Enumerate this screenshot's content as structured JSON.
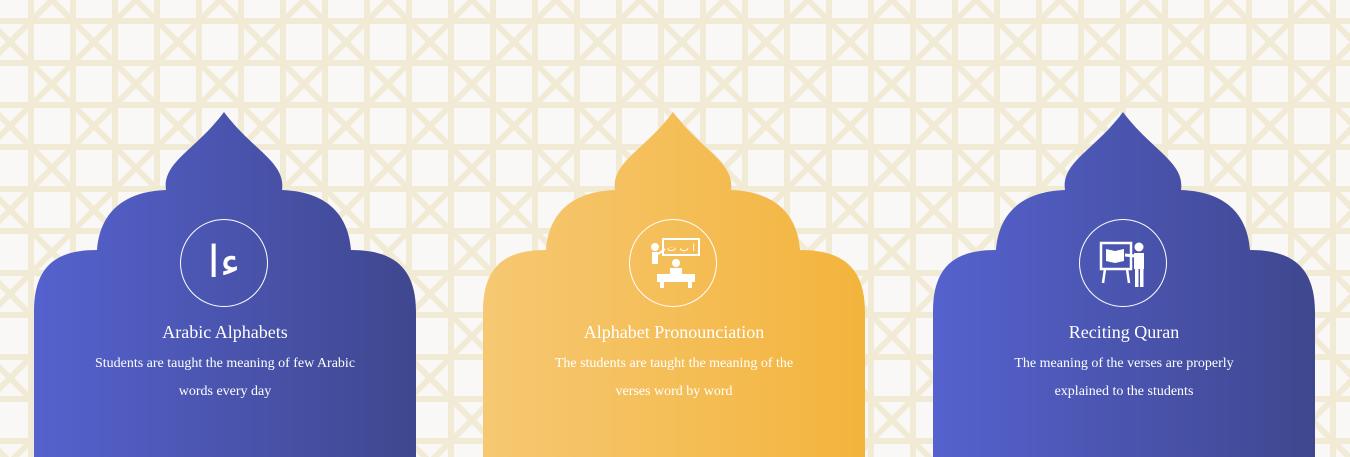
{
  "theme": {
    "blue_start": "#5562ce",
    "blue_end": "#3f478f",
    "gold_start": "#f6c873",
    "gold_end": "#f3b43c",
    "pattern_line": "#f1ebd6",
    "background": "#f9f8f6"
  },
  "cards": [
    {
      "title": "Arabic Alphabets",
      "description": "Students are taught the meaning of few Arabic words every day",
      "icon": "arabic-letters-icon",
      "icon_text": "ءا",
      "color": "blue"
    },
    {
      "title": "Alphabet Pronounciation",
      "description": "The students are taught the meaning of the verses word by word",
      "icon": "teacher-board-icon",
      "icon_text": "ا ب ت",
      "color": "gold"
    },
    {
      "title": "Reciting Quran",
      "description": "The meaning of the verses are properly explained to the students",
      "icon": "presenter-book-icon",
      "color": "blue"
    }
  ]
}
